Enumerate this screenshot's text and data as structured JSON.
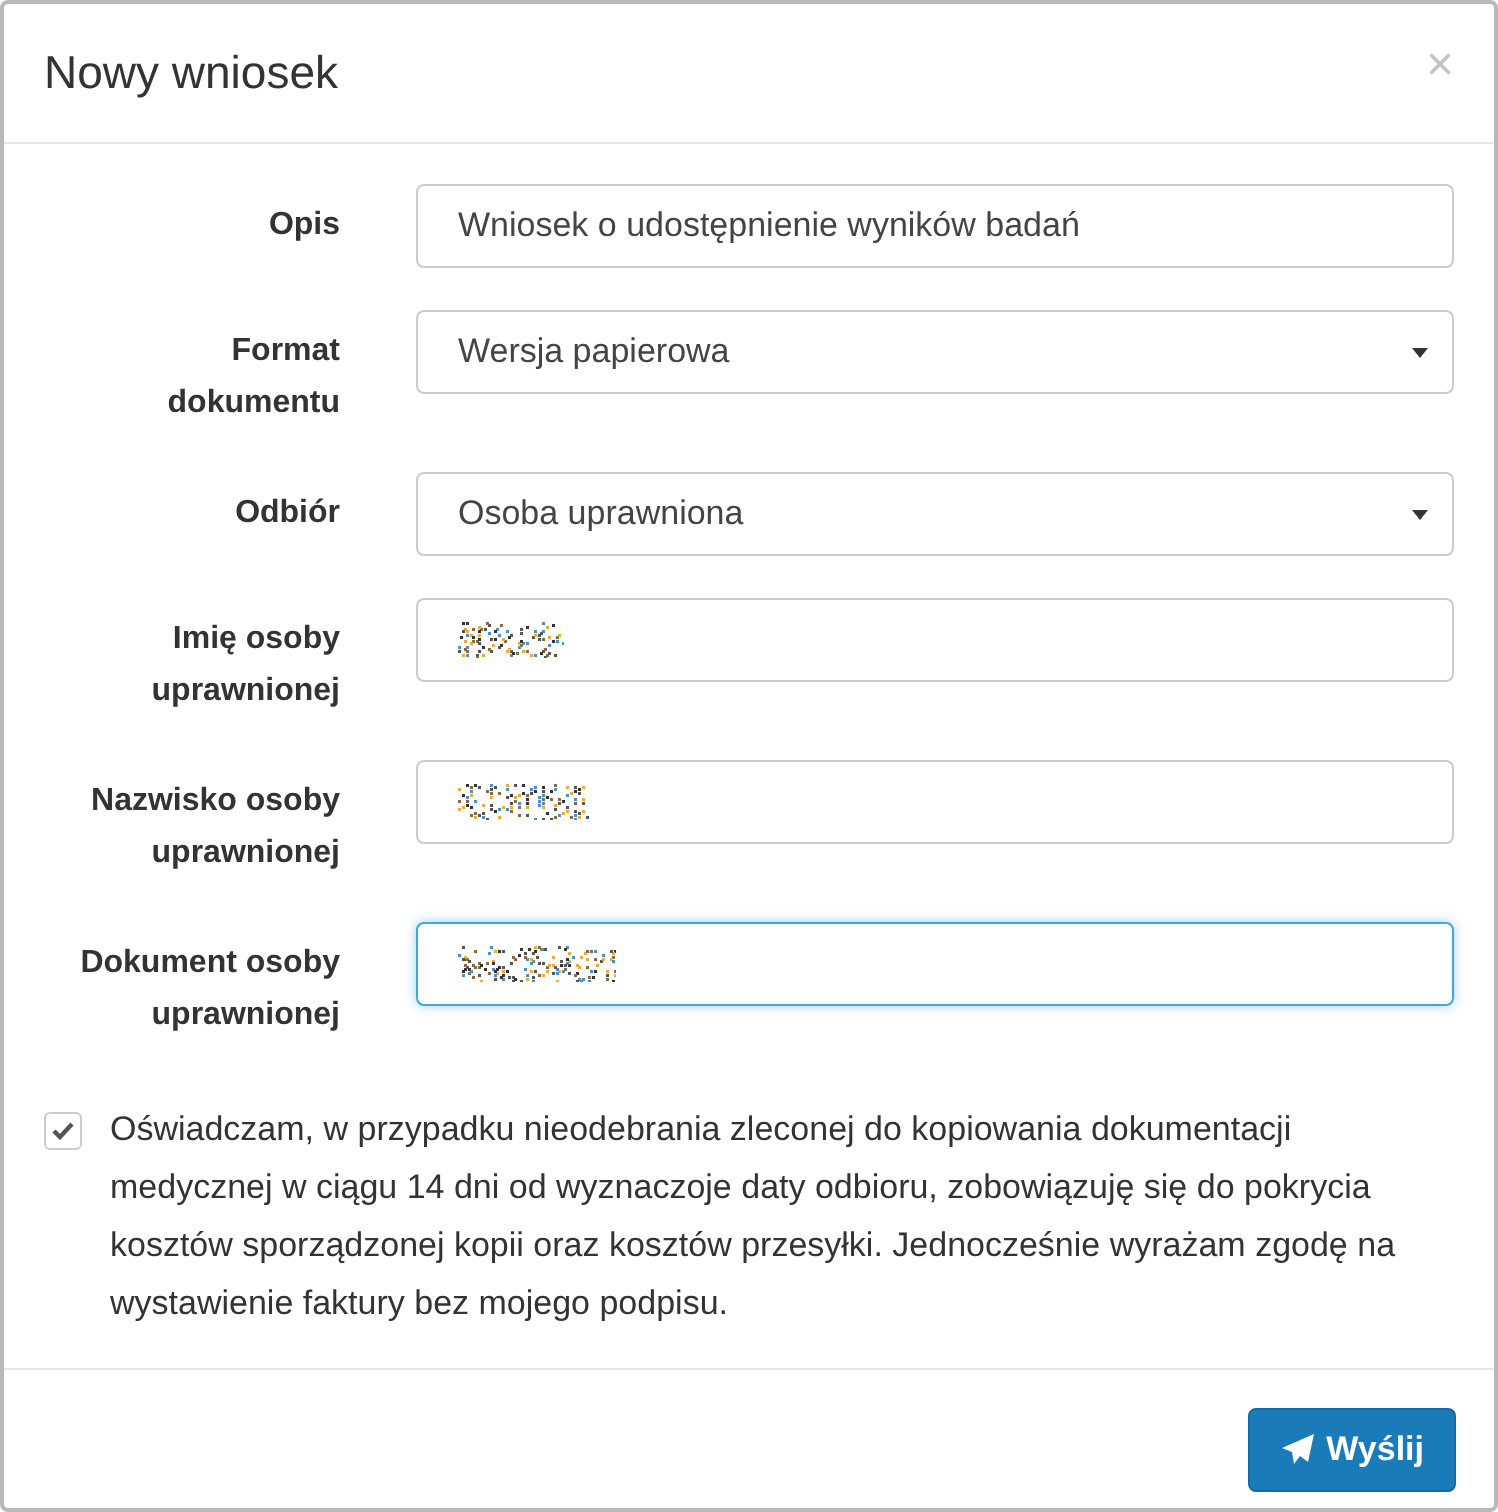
{
  "dialog": {
    "title": "Nowy wniosek",
    "close": "×"
  },
  "fields": [
    {
      "label": "Opis",
      "kind": "text",
      "value": "Wniosek o udostępnienie wyników badań",
      "focused": false
    },
    {
      "label": "Format dokumentu",
      "kind": "select",
      "value": "Wersja papierowa",
      "focused": false
    },
    {
      "label": "Odbiór",
      "kind": "select",
      "value": "Osoba uprawniona",
      "focused": false
    },
    {
      "label": "Imię osoby uprawnionej",
      "kind": "redacted",
      "focused": false
    },
    {
      "label": "Nazwisko osoby uprawnionej",
      "kind": "redacted",
      "focused": false
    },
    {
      "label": "Dokument osoby uprawnionej",
      "kind": "redacted",
      "focused": true
    }
  ],
  "consent": {
    "checked": true,
    "text": "Oświadczam, w przypadku nieodebrania zleconej do kopiowania dokumentacji medycznej w ciągu 14 dni od wyznaczoje daty odbioru, zobowiązuję się do pokrycia kosztów sporządzonej kopii oraz kosztów przesyłki. Jednocześnie wyrażam zgodę na wystawienie faktury bez mojego podpisu."
  },
  "submit": {
    "label": "Wyślij"
  }
}
